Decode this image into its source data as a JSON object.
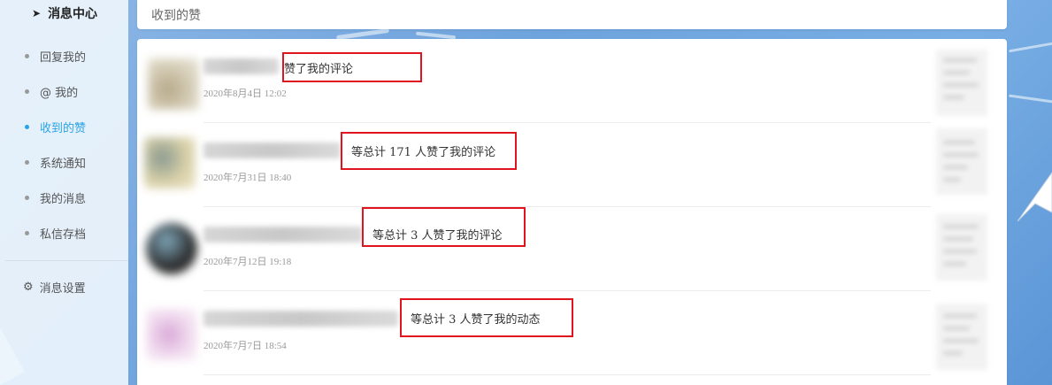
{
  "sidebar": {
    "title": "消息中心",
    "title_icon": "telegram-icon",
    "items": [
      {
        "label": "回复我的",
        "active": false
      },
      {
        "label": "@ 我的",
        "active": false
      },
      {
        "label": "收到的赞",
        "active": true
      },
      {
        "label": "系统通知",
        "active": false
      },
      {
        "label": "我的消息",
        "active": false
      },
      {
        "label": "私信存档",
        "active": false
      }
    ],
    "settings": {
      "label": "消息设置",
      "icon": "gear-icon"
    }
  },
  "header": {
    "title": "收到的赞"
  },
  "likes": [
    {
      "action": "赞了我的评论",
      "time": "2020年8月4日 12:02"
    },
    {
      "action": "等总计 171 人赞了我的评论",
      "time": "2020年7月31日 18:40"
    },
    {
      "action": "等总计 3 人赞了我的评论",
      "time": "2020年7月12日 19:18"
    },
    {
      "action": "等总计 3 人赞了我的动态",
      "time": "2020年7月7日 18:54"
    }
  ],
  "colors": {
    "accent": "#2aa3e6",
    "highlight_border": "#e0141e"
  }
}
